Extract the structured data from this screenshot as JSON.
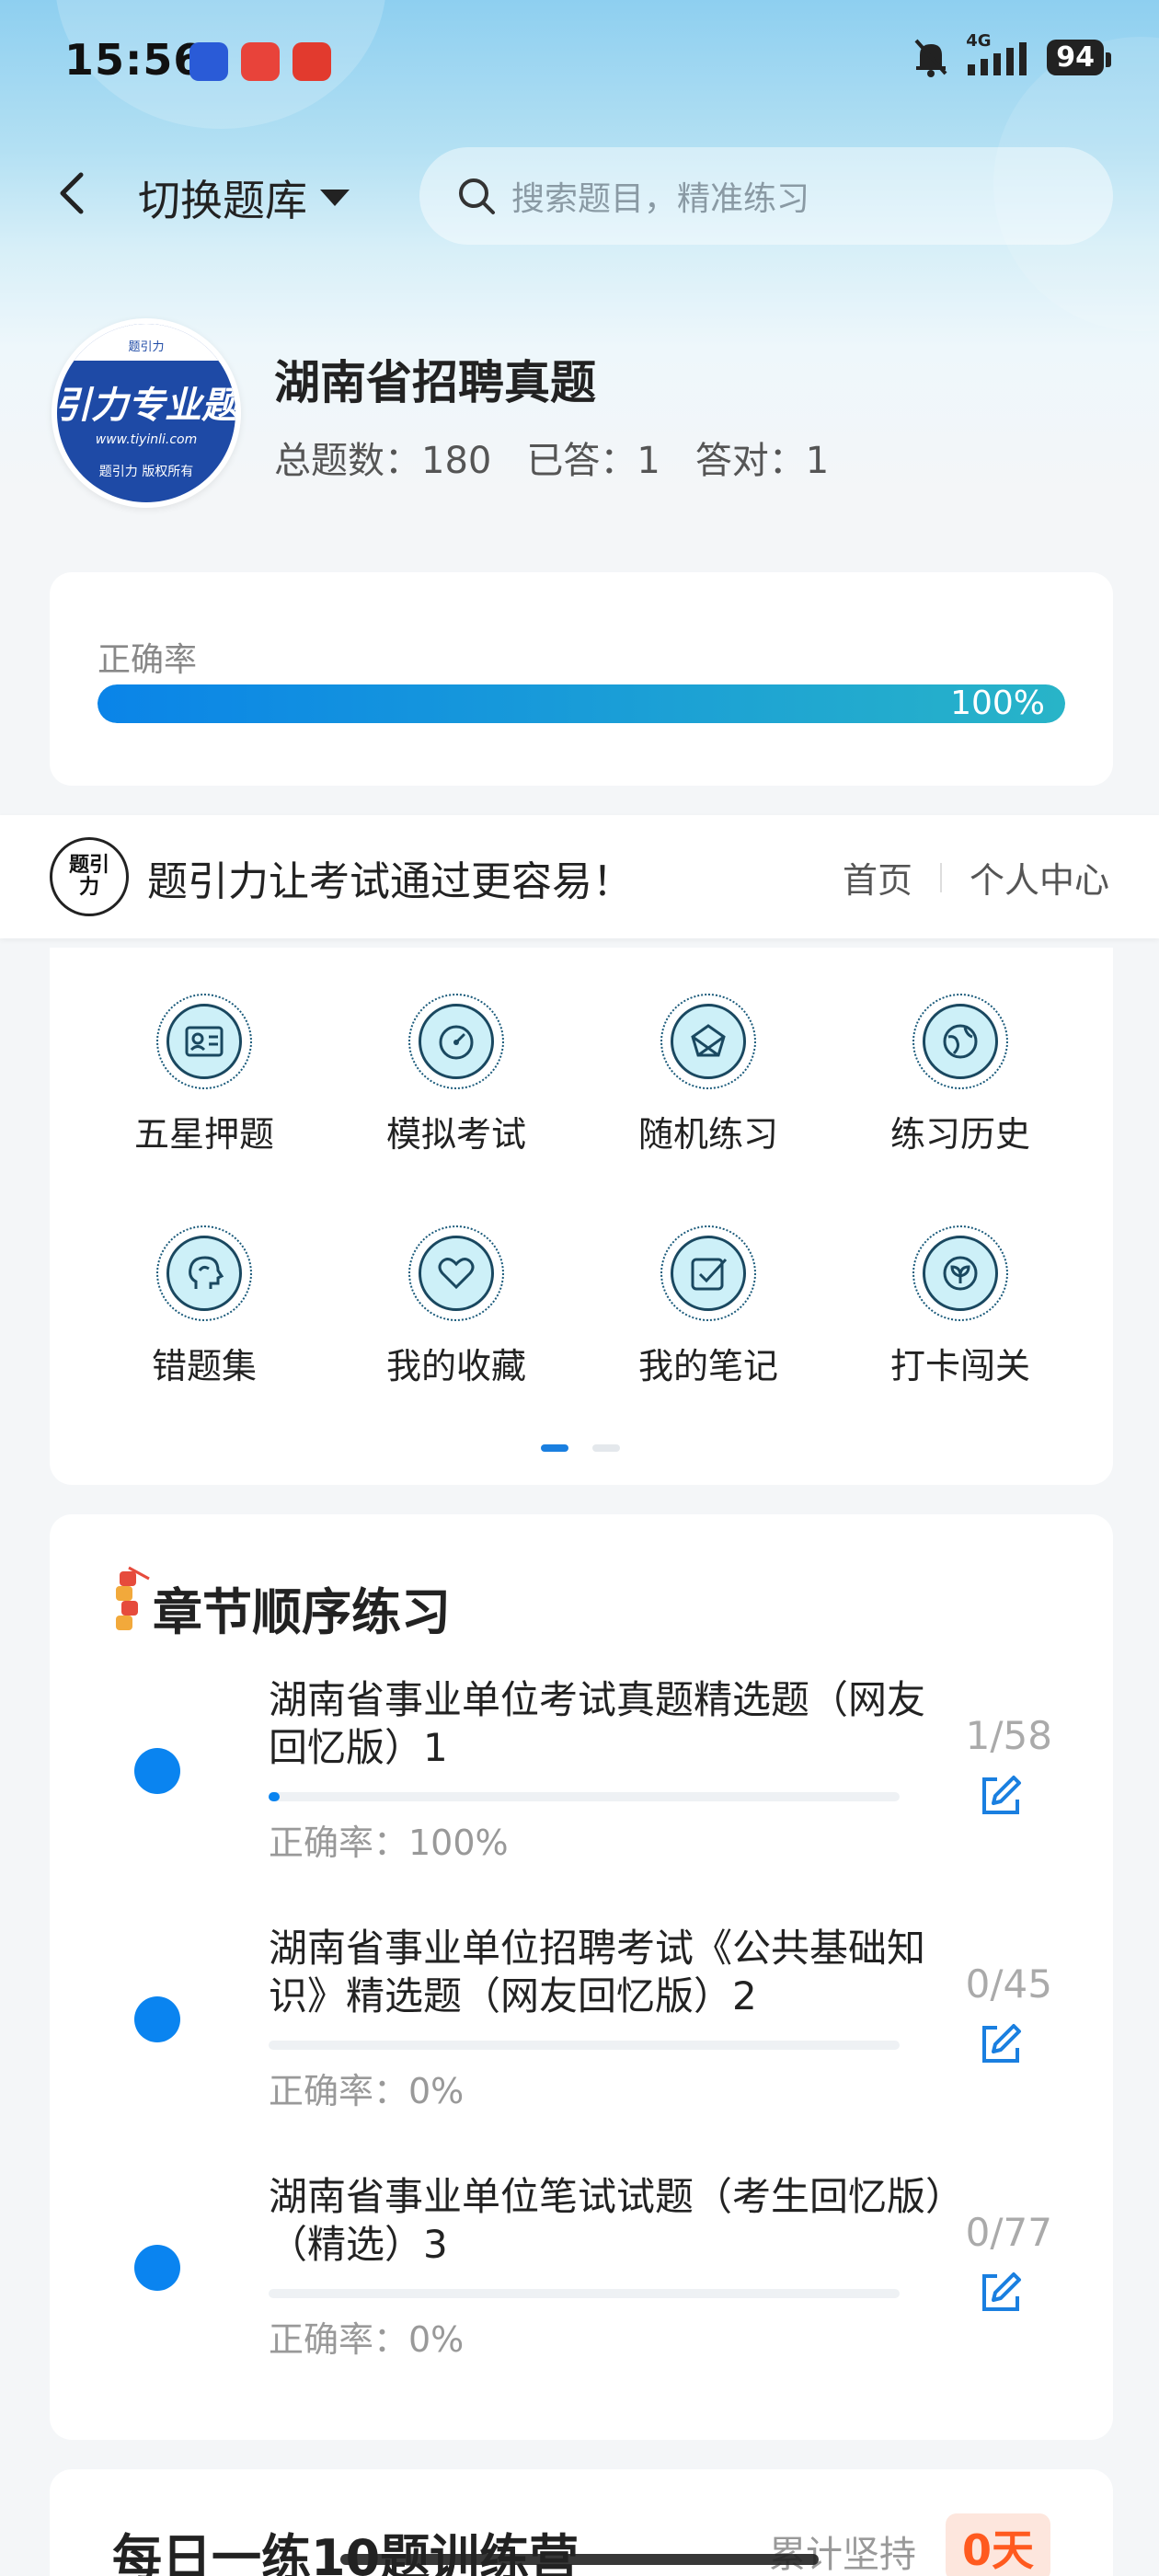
{
  "status_bar": {
    "time": "15:56",
    "network": "4G",
    "battery": "94"
  },
  "nav": {
    "switch_bank_label": "切换题库",
    "search_placeholder": "搜索题目，精准练习"
  },
  "bank": {
    "logo_top": "题引力",
    "logo_big": "引力专业题",
    "logo_url": "www.tiyinli.com",
    "logo_copy": "题引力 版权所有",
    "title": "湖南省招聘真题",
    "total": "总题数：180",
    "answered": "已答：1",
    "correct": "答对：1"
  },
  "accuracy": {
    "label": "正确率",
    "percent_text": "100%",
    "percent_value": 100
  },
  "brand": {
    "logo_text": "题引力",
    "slogan": "题引力让考试通过更容易！",
    "links": [
      "首页",
      "个人中心"
    ]
  },
  "functions": [
    {
      "label": "五星押题",
      "icon": "id-card-icon"
    },
    {
      "label": "模拟考试",
      "icon": "speedometer-icon"
    },
    {
      "label": "随机练习",
      "icon": "network-icon"
    },
    {
      "label": "练习历史",
      "icon": "globe-icon"
    },
    {
      "label": "错题集",
      "icon": "head-icon"
    },
    {
      "label": "我的收藏",
      "icon": "heart-icon"
    },
    {
      "label": "我的笔记",
      "icon": "checkbox-icon"
    },
    {
      "label": "打卡闯关",
      "icon": "leaf-icon"
    }
  ],
  "pager": {
    "pages": 2,
    "active": 0
  },
  "chapters": {
    "title": "章节顺序练习",
    "items": [
      {
        "name": "湖南省事业单位考试真题精选题（网友回忆版）1",
        "count": "1/58",
        "accuracy": "正确率：100%",
        "progress": 0.017
      },
      {
        "name": "湖南省事业单位招聘考试《公共基础知识》精选题（网友回忆版）2",
        "count": "0/45",
        "accuracy": "正确率：0%",
        "progress": 0
      },
      {
        "name": "湖南省事业单位笔试试题（考生回忆版）（精选）3",
        "count": "0/77",
        "accuracy": "正确率：0%",
        "progress": 0
      }
    ]
  },
  "daily": {
    "title": "每日一练10题训练营",
    "streak_label": "累计坚持",
    "streak_value": "0天"
  },
  "colors": {
    "accent": "#0a84f0",
    "streak": "#ff5a1f"
  }
}
